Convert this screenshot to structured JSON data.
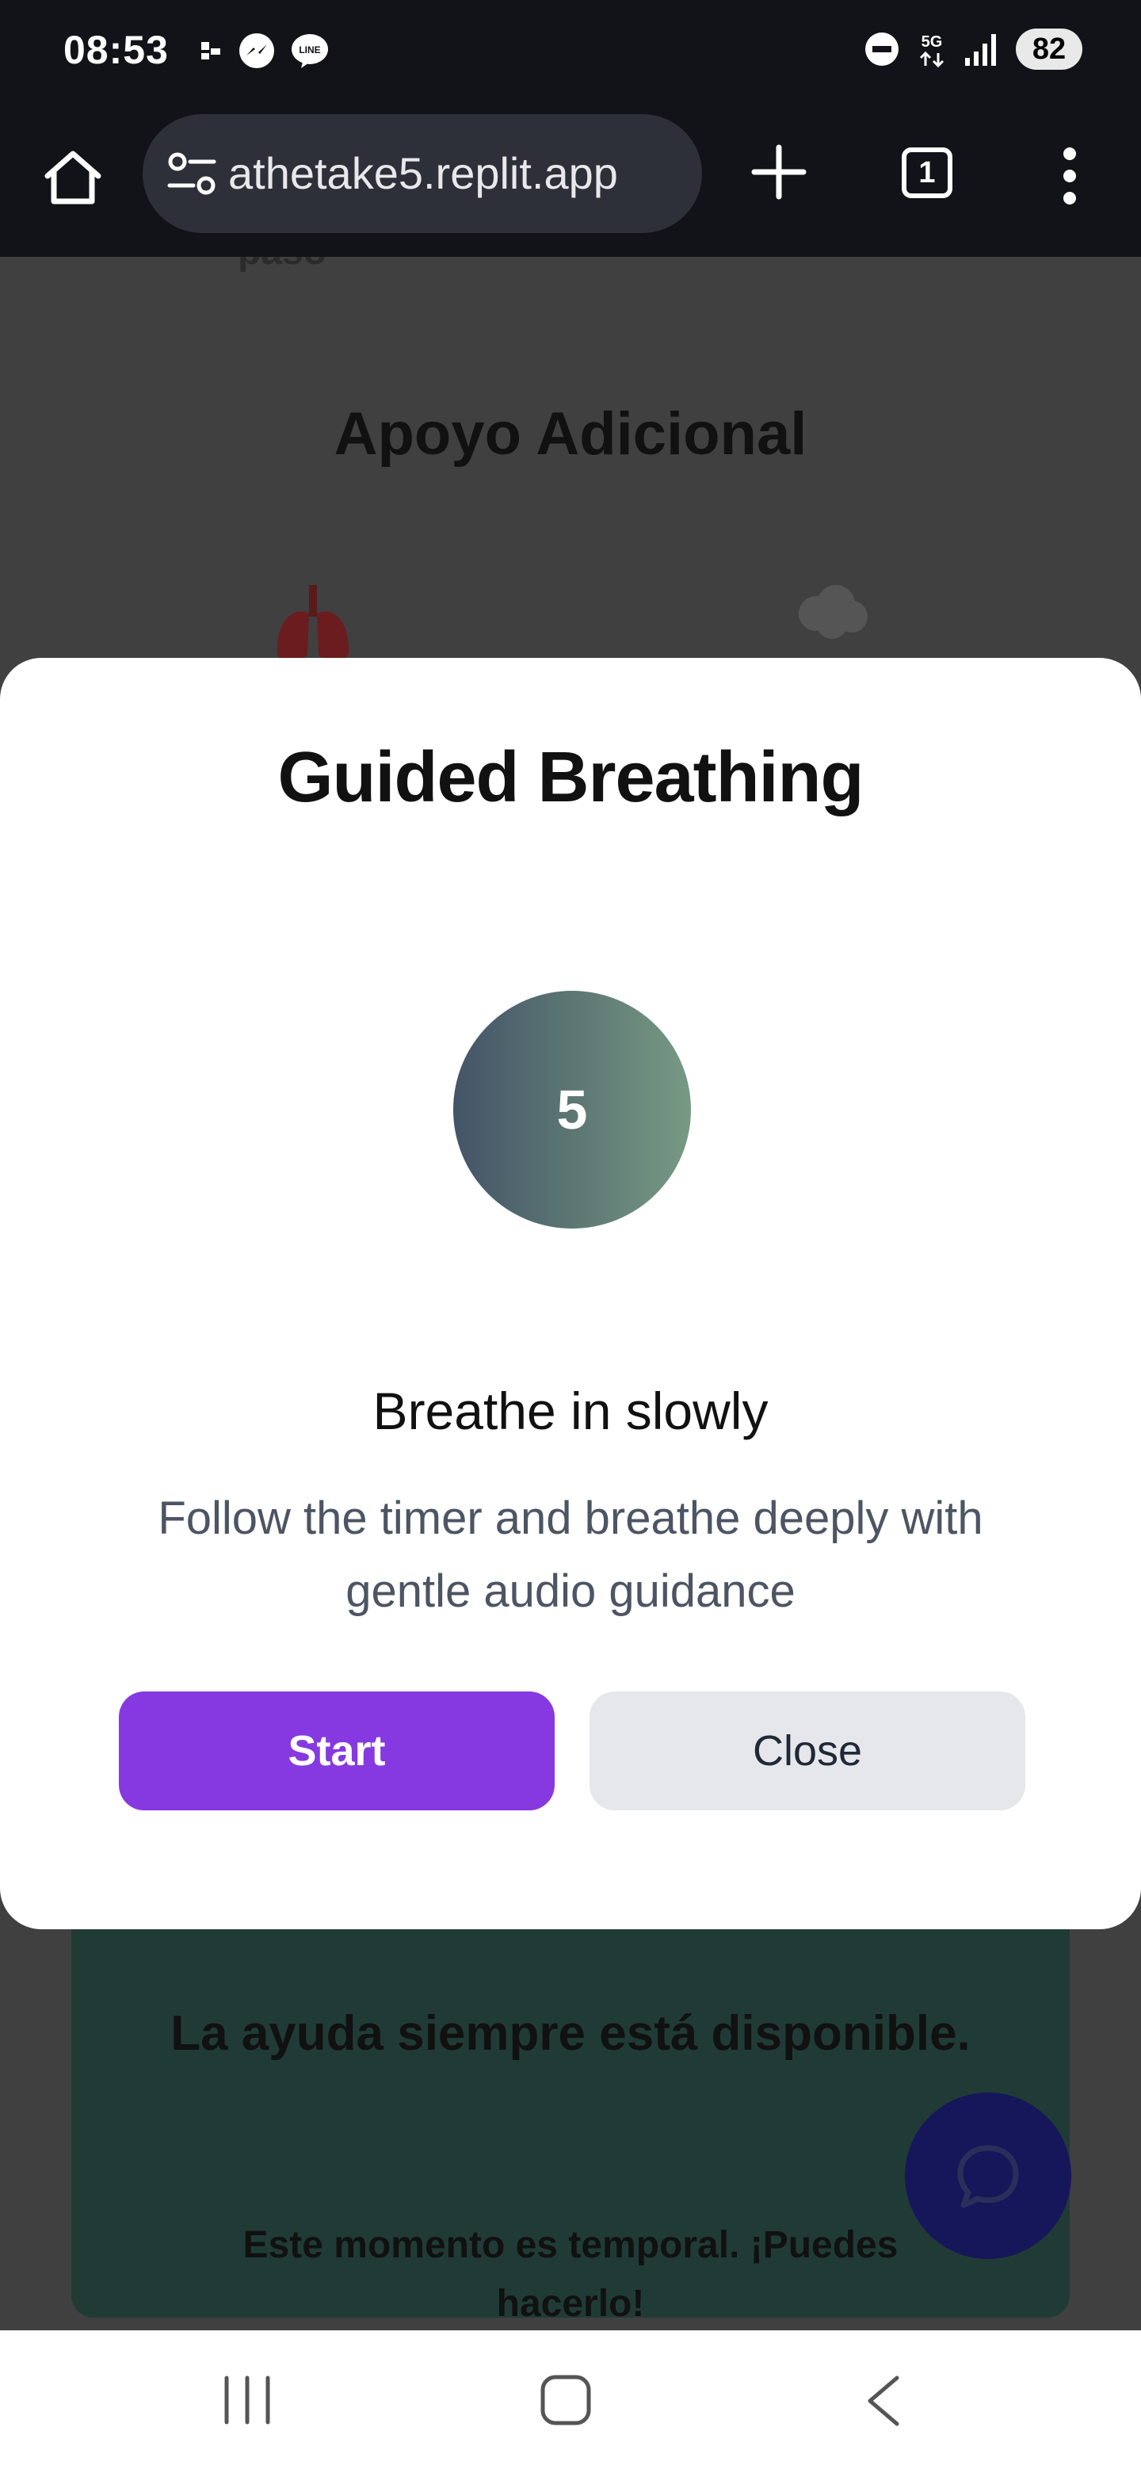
{
  "status_bar": {
    "time": "08:53",
    "battery": "82",
    "network": "5G"
  },
  "browser": {
    "url": "athetake5.replit.app",
    "tab_count": "1"
  },
  "background_page": {
    "clipped_text": "paso",
    "section_heading": "Apoyo Adicional",
    "card_title": "La ayuda siempre está disponible.",
    "card_text": "Este momento es temporal. ¡Puedes hacerlo!"
  },
  "modal": {
    "title": "Guided Breathing",
    "counter": "5",
    "instruction": "Breathe in slowly",
    "description": "Follow the timer and breathe deeply with gentle audio guidance",
    "start_label": "Start",
    "close_label": "Close"
  },
  "colors": {
    "accent": "#8639e0",
    "overlay_bg": "#404040",
    "circle_start": "#445468",
    "circle_end": "#779a84"
  }
}
